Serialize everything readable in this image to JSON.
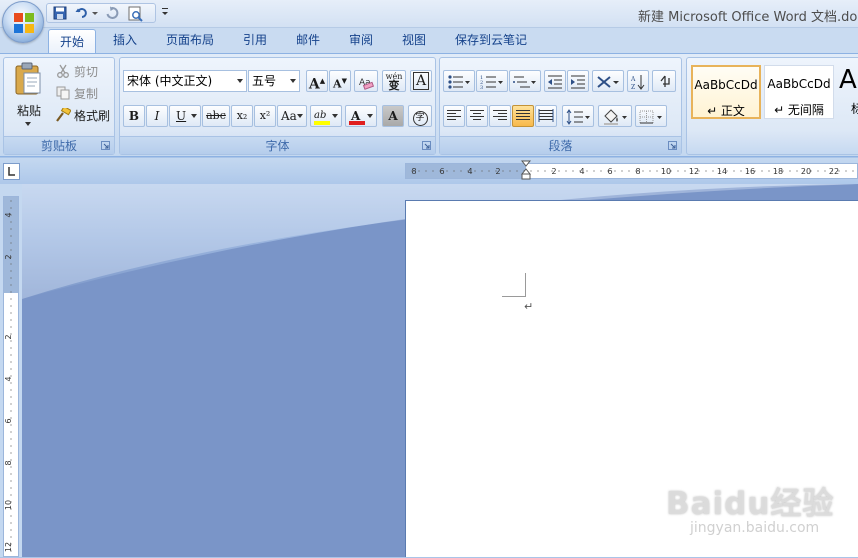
{
  "window": {
    "title": "新建 Microsoft Office Word 文档.docx"
  },
  "quick_access": {
    "icons": [
      "save-icon",
      "undo-icon",
      "redo-icon",
      "print-preview-icon",
      "customize-icon"
    ]
  },
  "tabs": [
    {
      "label": "开始",
      "active": true
    },
    {
      "label": "插入"
    },
    {
      "label": "页面布局"
    },
    {
      "label": "引用"
    },
    {
      "label": "邮件"
    },
    {
      "label": "审阅"
    },
    {
      "label": "视图"
    },
    {
      "label": "保存到云笔记"
    }
  ],
  "clipboard": {
    "label": "剪贴板",
    "paste": "粘贴",
    "cut": "剪切",
    "copy": "复制",
    "format_painter": "格式刷"
  },
  "font": {
    "label": "字体",
    "font_name": "宋体 (中文正文)",
    "font_size": "五号",
    "grow": "A",
    "shrink": "A",
    "phonetic": "wén",
    "phonetic_char": "变",
    "char_border": "A",
    "bold": "B",
    "italic": "I",
    "underline": "U",
    "strikethrough": "abc",
    "subscript": "x₂",
    "superscript": "x²",
    "change_case": "Aa",
    "highlight": "ab",
    "font_color": "A",
    "char_shading": "A",
    "enclose": "字",
    "highlight_color": "#ffff00",
    "font_color_value": "#e01e1e"
  },
  "paragraph": {
    "label": "段落"
  },
  "styles": {
    "items": [
      {
        "sample": "AaBbCcDd",
        "name": "↵ 正文",
        "selected": true
      },
      {
        "sample": "AaBbCcDd",
        "name": "↵ 无间隔"
      },
      {
        "sample": "A",
        "name": "标"
      }
    ]
  },
  "ruler": {
    "horizontal_ticks": [
      "8",
      "6",
      "4",
      "2",
      "2",
      "4",
      "6",
      "8",
      "10",
      "12",
      "14",
      "16",
      "18",
      "20",
      "22"
    ],
    "vertical_ticks": [
      "4",
      "2",
      "2",
      "4",
      "6",
      "8",
      "10",
      "12"
    ]
  },
  "document": {
    "paragraph_mark": "↵"
  },
  "watermark": {
    "text": "Baidu经验",
    "sub": "jingyan.baidu.com"
  }
}
